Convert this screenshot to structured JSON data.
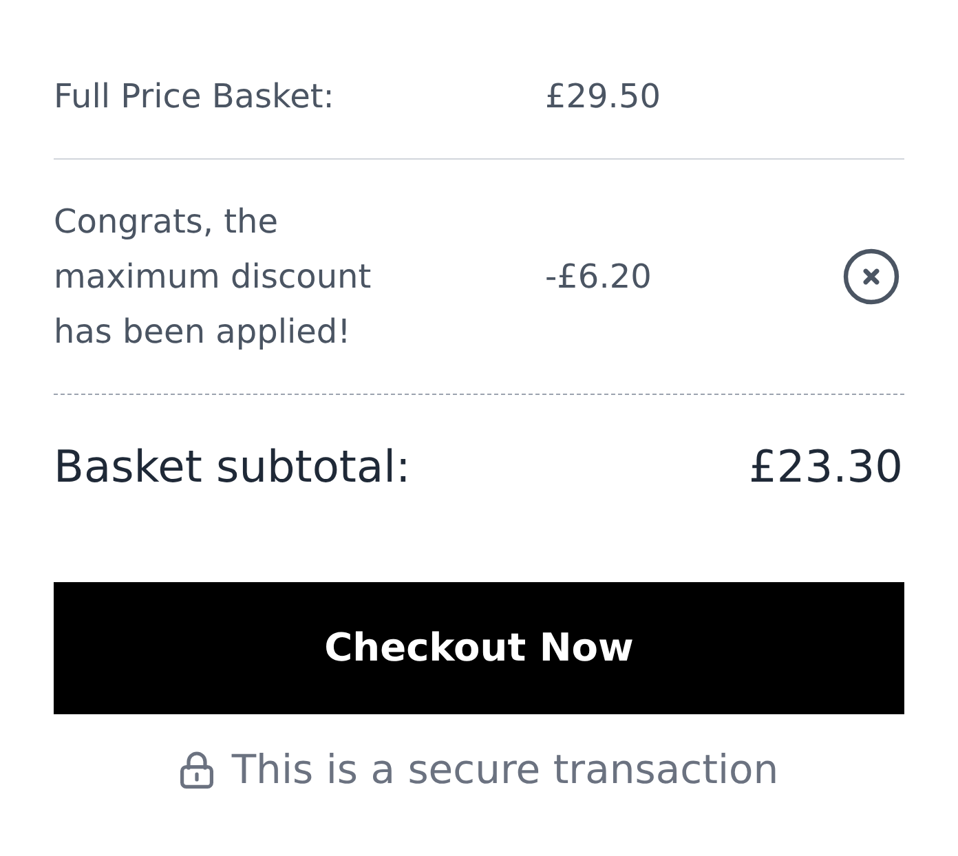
{
  "summary_rows": [
    {
      "kind": "line",
      "label": "Full Price Basket:",
      "value": "£29.50"
    },
    {
      "kind": "discount",
      "label": "Congrats, the maximum discount has been applied!",
      "value": "-£6.20"
    }
  ],
  "subtotal": {
    "label": "Basket subtotal:",
    "value": "£23.30"
  },
  "checkout_button": {
    "label": "Checkout Now"
  },
  "secure_note": {
    "text": "This is a secure transaction"
  }
}
